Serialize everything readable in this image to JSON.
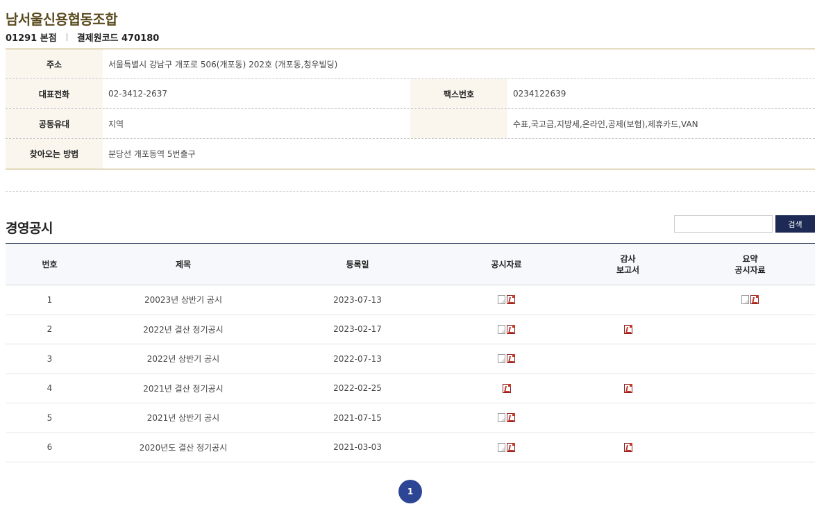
{
  "org": {
    "name": "남서울신용협동조합",
    "branch": "01291 본점",
    "code": "결제원코드 470180"
  },
  "info": {
    "address_label": "주소",
    "address": "서울특별시 강남구 개포로 506(개포동) 202호 (개포동,청우빌딩)",
    "phone_label": "대표전화",
    "phone": "02-3412-2637",
    "fax_label": "팩스번호",
    "fax": "0234122639",
    "bond_label": "공동유대",
    "bond": "지역",
    "services": "수표,국고금,지방세,온라인,공제(보험),제휴카드,VAN",
    "directions_label": "찾아오는 방법",
    "directions": "분당선 개포동역 5번출구"
  },
  "section": {
    "title": "경영공시",
    "search_placeholder": "",
    "search_button": "검색"
  },
  "columns": {
    "no": "번호",
    "title": "제목",
    "date": "등록일",
    "doc": "공시자료",
    "audit": "감사\n보고서",
    "summary": "요약\n공시자료"
  },
  "rows": [
    {
      "no": "1",
      "title": "20023년 상반기 공시",
      "date": "2023-07-13",
      "doc": [
        "doc-icon",
        "pdf-icon"
      ],
      "audit": [],
      "summary": [
        "doc-icon",
        "pdf-icon"
      ]
    },
    {
      "no": "2",
      "title": "2022년 결산 정기공시",
      "date": "2023-02-17",
      "doc": [
        "doc-icon",
        "pdf-icon"
      ],
      "audit": [
        "pdf-icon"
      ],
      "summary": []
    },
    {
      "no": "3",
      "title": "2022년 상반기 공시",
      "date": "2022-07-13",
      "doc": [
        "doc-icon",
        "pdf-icon"
      ],
      "audit": [],
      "summary": []
    },
    {
      "no": "4",
      "title": "2021년 결산 정기공시",
      "date": "2022-02-25",
      "doc": [
        "pdf-icon"
      ],
      "audit": [
        "pdf-icon"
      ],
      "summary": []
    },
    {
      "no": "5",
      "title": "2021년 상반기 공시",
      "date": "2021-07-15",
      "doc": [
        "doc-icon",
        "pdf-icon"
      ],
      "audit": [],
      "summary": []
    },
    {
      "no": "6",
      "title": "2020년도 결산 정기공시",
      "date": "2021-03-03",
      "doc": [
        "doc-icon",
        "pdf-icon"
      ],
      "audit": [
        "pdf-icon"
      ],
      "summary": []
    }
  ],
  "pagination": {
    "current": "1"
  },
  "colors": {
    "brand": "#5a4a1e",
    "accent": "#2d4595",
    "button": "#1c2a55",
    "border_gold": "#b89c52"
  }
}
